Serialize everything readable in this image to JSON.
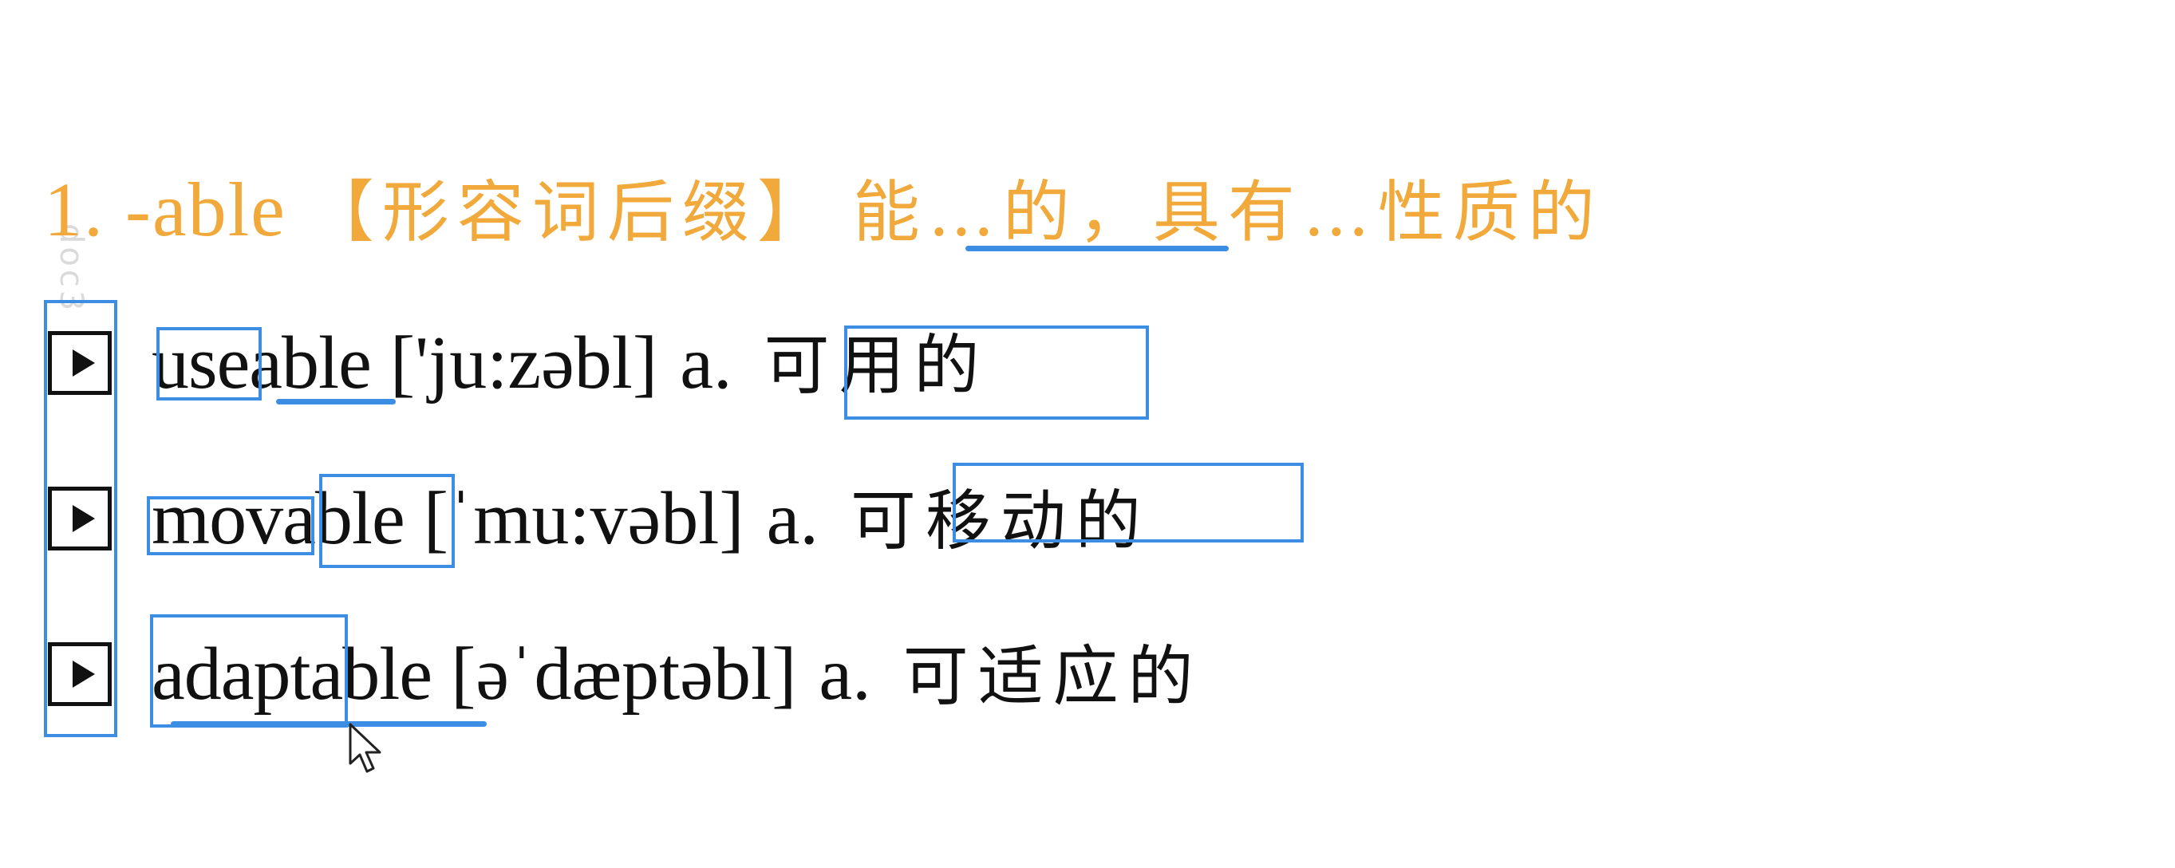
{
  "heading": {
    "number": "1.",
    "suffix": "-able",
    "bracket_text": "【形容词后缀】",
    "meaning": "能…的，具有…性质的"
  },
  "watermark": {
    "text": "doc3"
  },
  "entries": [
    {
      "word": "useable",
      "pronunciation": "['ju:zəbl]",
      "pos": "a.",
      "meaning": "可用的"
    },
    {
      "word": "movable",
      "pronunciation": "[ˈmu:vəbl]",
      "pos": "a.",
      "meaning": "可移动的"
    },
    {
      "word": "adaptable",
      "pronunciation": "[əˈdæptəbl]",
      "pos": "a.",
      "meaning": "可适应的"
    }
  ],
  "colors": {
    "heading": "#f0a93a",
    "annotation": "#3b8ee3",
    "text": "#111111"
  },
  "icons": {
    "play": "play-icon",
    "cursor": "mouse-pointer-icon"
  }
}
